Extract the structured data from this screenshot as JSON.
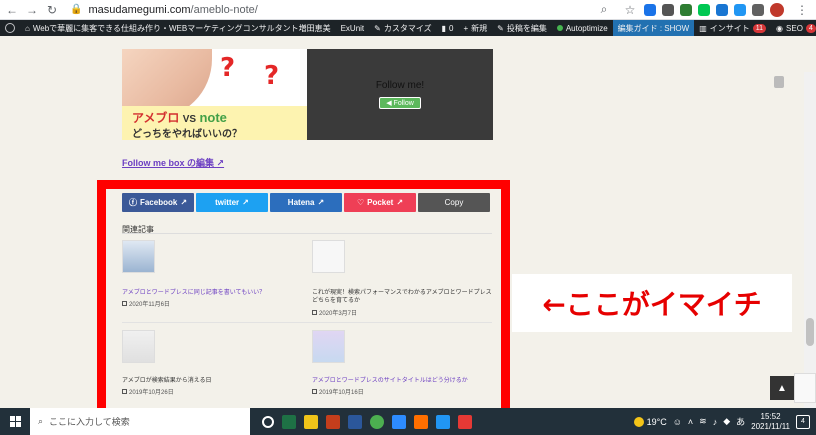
{
  "browser": {
    "url_host": "masudamegumi.com",
    "url_path": "/ameblo-note/"
  },
  "adminbar": {
    "site_title": "Webで華麗に集客できる仕組み作り・WEBマーケティングコンサルタント増田恵美",
    "exunit": "ExUnit",
    "customize": "カスタマイズ",
    "comments": "0",
    "new": "新規",
    "edit_post": "投稿を編集",
    "autoptimize": "Autoptimize",
    "guide": "編集ガイド : SHOW",
    "insight": "インサイト",
    "insight_count": "11",
    "seo": "SEO",
    "seo_count": "4"
  },
  "eyecatch": {
    "qmark": "?",
    "ameblo": "アメブロ",
    "vs": "VS",
    "note": "note",
    "question": "どっちをやればいいの？"
  },
  "followme": {
    "title": "Follow me!",
    "button": "Follow"
  },
  "edit_link": "Follow me box の編集",
  "share": {
    "facebook": "Facebook",
    "twitter": "twitter",
    "hatena": "Hatena",
    "pocket": "Pocket",
    "copy": "Copy"
  },
  "related": {
    "heading": "関連記事",
    "items": [
      {
        "title": "アメブロとワードプレスに同じ記事を書いてもいい？",
        "date": "2020年11月6日"
      },
      {
        "title": "これが現実！検索パフォーマンスでわかるアメブロとワードプレスどちらを育てるか",
        "date": "2020年3月7日"
      },
      {
        "title": "アメブロが検索結果から消える日",
        "date": "2019年10月26日"
      },
      {
        "title": "アメブロとワードプレスのサイトタイトルはどう分けるか",
        "date": "2019年10月16日"
      }
    ]
  },
  "annotation": "←ここがイマイチ",
  "taskbar": {
    "search_placeholder": "ここに入力して検索",
    "temperature": "19°C",
    "ime": "あ",
    "time": "15:52",
    "date": "2021/11/11",
    "notifications": "4"
  },
  "colors": {
    "highlight_red": "#ff0000",
    "link_purple": "#6c3fc2",
    "facebook": "#3b5998",
    "twitter": "#1da1f2",
    "hatena": "#2c6ebd",
    "pocket": "#ef3f56"
  }
}
